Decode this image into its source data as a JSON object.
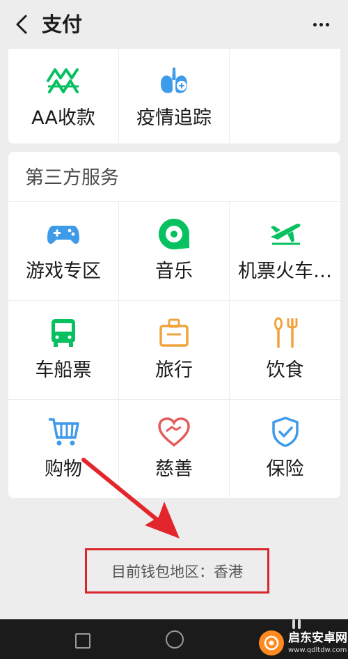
{
  "header": {
    "title": "支付"
  },
  "top_services": [
    {
      "label": "AA收款",
      "icon": "aa-collect-icon"
    },
    {
      "label": "疫情追踪",
      "icon": "lungs-icon"
    }
  ],
  "third_party": {
    "title": "第三方服务",
    "items": [
      {
        "label": "游戏专区",
        "icon": "gamepad-icon"
      },
      {
        "label": "音乐",
        "icon": "music-icon"
      },
      {
        "label": "机票火车…",
        "icon": "airplane-icon"
      },
      {
        "label": "车船票",
        "icon": "bus-icon"
      },
      {
        "label": "旅行",
        "icon": "luggage-icon"
      },
      {
        "label": "饮食",
        "icon": "utensils-icon"
      },
      {
        "label": "购物",
        "icon": "shopping-cart-icon"
      },
      {
        "label": "慈善",
        "icon": "charity-heart-icon"
      },
      {
        "label": "保险",
        "icon": "shield-check-icon"
      }
    ]
  },
  "footer": {
    "wallet_region": "目前钱包地区：香港"
  },
  "watermark": {
    "name": "启东安卓网",
    "url": "www.qdltdw.com"
  },
  "colors": {
    "green": "#07c160",
    "blue": "#3d9be9",
    "orange": "#f0a33a",
    "red": "#e65a5a",
    "highlight": "#d9252b"
  }
}
